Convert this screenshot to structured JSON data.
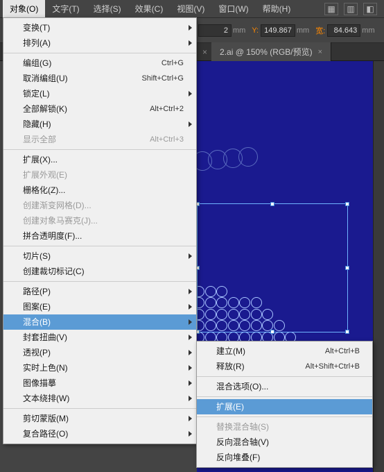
{
  "menubar": {
    "items": [
      {
        "label": "对象(O)"
      },
      {
        "label": "文字(T)"
      },
      {
        "label": "选择(S)"
      },
      {
        "label": "效果(C)"
      },
      {
        "label": "视图(V)"
      },
      {
        "label": "窗口(W)"
      },
      {
        "label": "帮助(H)"
      }
    ]
  },
  "controlbar": {
    "x_suffix": "2",
    "y_label": "Y:",
    "y_value": "149.867",
    "w_label": "宽:",
    "w_value": "84.643",
    "mm": "mm"
  },
  "tabs": {
    "active": {
      "label": "2.ai @ 150% (RGB/预览)",
      "close": "×"
    }
  },
  "menu_object": {
    "sections": [
      [
        {
          "label": "变换(T)",
          "submenu": true
        },
        {
          "label": "排列(A)",
          "submenu": true
        }
      ],
      [
        {
          "label": "编组(G)",
          "shortcut": "Ctrl+G"
        },
        {
          "label": "取消编组(U)",
          "shortcut": "Shift+Ctrl+G"
        },
        {
          "label": "锁定(L)",
          "submenu": true
        },
        {
          "label": "全部解锁(K)",
          "shortcut": "Alt+Ctrl+2"
        },
        {
          "label": "隐藏(H)",
          "submenu": true
        },
        {
          "label": "显示全部",
          "shortcut": "Alt+Ctrl+3",
          "disabled": true
        }
      ],
      [
        {
          "label": "扩展(X)..."
        },
        {
          "label": "扩展外观(E)",
          "disabled": true
        },
        {
          "label": "栅格化(Z)..."
        },
        {
          "label": "创建渐变网格(D)...",
          "disabled": true
        },
        {
          "label": "创建对象马赛克(J)...",
          "disabled": true
        },
        {
          "label": "拼合透明度(F)..."
        }
      ],
      [
        {
          "label": "切片(S)",
          "submenu": true
        },
        {
          "label": "创建裁切标记(C)"
        }
      ],
      [
        {
          "label": "路径(P)",
          "submenu": true
        },
        {
          "label": "图案(E)",
          "submenu": true
        },
        {
          "label": "混合(B)",
          "submenu": true,
          "highlighted": true
        },
        {
          "label": "封套扭曲(V)",
          "submenu": true
        },
        {
          "label": "透视(P)",
          "submenu": true
        },
        {
          "label": "实时上色(N)",
          "submenu": true
        },
        {
          "label": "图像描摹",
          "submenu": true
        },
        {
          "label": "文本绕排(W)",
          "submenu": true
        }
      ],
      [
        {
          "label": "剪切蒙版(M)",
          "submenu": true
        },
        {
          "label": "复合路径(O)",
          "submenu": true
        }
      ]
    ]
  },
  "submenu_blend": {
    "sections": [
      [
        {
          "label": "建立(M)",
          "shortcut": "Alt+Ctrl+B"
        },
        {
          "label": "释放(R)",
          "shortcut": "Alt+Shift+Ctrl+B"
        }
      ],
      [
        {
          "label": "混合选项(O)..."
        }
      ],
      [
        {
          "label": "扩展(E)",
          "highlighted": true
        }
      ],
      [
        {
          "label": "替换混合轴(S)",
          "disabled": true
        },
        {
          "label": "反向混合轴(V)"
        },
        {
          "label": "反向堆叠(F)"
        }
      ]
    ]
  },
  "icons": {
    "tool1": "▦",
    "tool2": "▥",
    "tool3": "◧"
  }
}
